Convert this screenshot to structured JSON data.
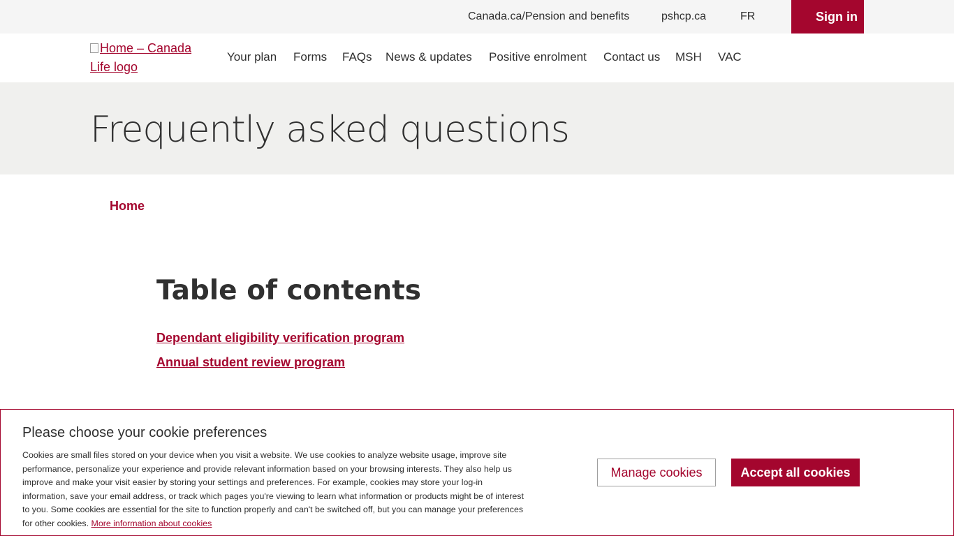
{
  "utility": {
    "pension_link": "Canada.ca/Pension and benefits",
    "pshcp_link": "pshcp.ca",
    "lang_link": "FR",
    "signin": "Sign in"
  },
  "header": {
    "logo_alt": "Home – Canada Life logo",
    "nav": [
      "Your plan",
      "Forms",
      "FAQs",
      "News & updates",
      "Positive enrolment",
      "Contact us",
      "MSH",
      "VAC"
    ]
  },
  "hero": {
    "title": "Frequently asked questions"
  },
  "breadcrumb": {
    "home": "Home"
  },
  "toc": {
    "heading": "Table of contents",
    "links": [
      "Dependant eligibility verification program",
      "Annual student review program"
    ]
  },
  "cookie": {
    "title": "Please choose your cookie preferences",
    "body": "Cookies are small files stored on your device when you visit a website. We use cookies to analyze website usage, improve site performance, personalize your experience and provide relevant information based on your browsing interests. They also help us improve and make your visit easier by storing your settings and preferences. For example, cookies may store your log-in information, save your email address, or track which pages you're viewing to learn what information or products might be of interest to you. Some cookies are essential for the site to function properly and can't be switched off, but you can manage your preferences for other cookies.",
    "more_link": "More information about cookies",
    "manage_btn": "Manage cookies",
    "accept_btn": "Accept all cookies"
  },
  "colors": {
    "brand": "#a4062e",
    "hero_bg": "#f0f0ee",
    "utility_bg": "#f5f5f5"
  }
}
